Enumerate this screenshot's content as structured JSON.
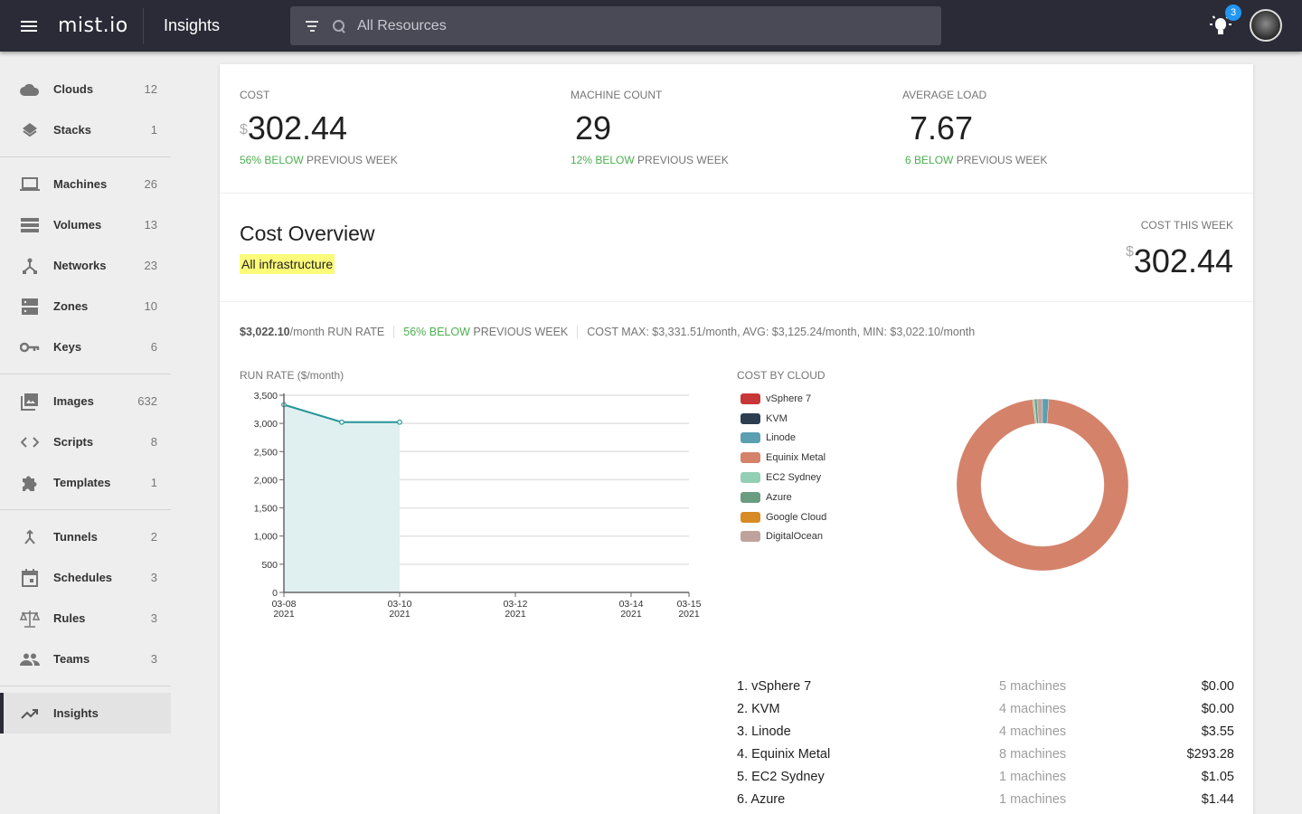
{
  "topbar": {
    "logo": "mist.io",
    "page_title": "Insights",
    "search_placeholder": "All Resources",
    "notification_count": "3"
  },
  "sidebar": {
    "groups": [
      [
        {
          "label": "Clouds",
          "count": "12",
          "icon": "cloud-icon"
        },
        {
          "label": "Stacks",
          "count": "1",
          "icon": "layers-icon"
        }
      ],
      [
        {
          "label": "Machines",
          "count": "26",
          "icon": "laptop-icon"
        },
        {
          "label": "Volumes",
          "count": "13",
          "icon": "storage-icon"
        },
        {
          "label": "Networks",
          "count": "23",
          "icon": "network-icon"
        },
        {
          "label": "Zones",
          "count": "10",
          "icon": "dns-icon"
        },
        {
          "label": "Keys",
          "count": "6",
          "icon": "key-icon"
        }
      ],
      [
        {
          "label": "Images",
          "count": "632",
          "icon": "images-icon"
        },
        {
          "label": "Scripts",
          "count": "8",
          "icon": "code-icon"
        },
        {
          "label": "Templates",
          "count": "1",
          "icon": "puzzle-icon"
        }
      ],
      [
        {
          "label": "Tunnels",
          "count": "2",
          "icon": "merge-icon"
        },
        {
          "label": "Schedules",
          "count": "3",
          "icon": "calendar-icon"
        },
        {
          "label": "Rules",
          "count": "3",
          "icon": "scale-icon"
        },
        {
          "label": "Teams",
          "count": "3",
          "icon": "people-icon"
        }
      ],
      [
        {
          "label": "Insights",
          "count": "",
          "icon": "trending-up-icon",
          "active": true
        }
      ]
    ]
  },
  "kpis": [
    {
      "label": "COST",
      "currency": "$",
      "value": "302.44",
      "delta": "56% BELOW",
      "suffix": " PREVIOUS WEEK"
    },
    {
      "label": "MACHINE COUNT",
      "currency": "",
      "value": "29",
      "delta": "12% BELOW",
      "suffix": " PREVIOUS WEEK"
    },
    {
      "label": "AVERAGE LOAD",
      "currency": "",
      "value": "7.67",
      "delta": "6 BELOW",
      "suffix": " PREVIOUS WEEK"
    }
  ],
  "overview": {
    "title": "Cost Overview",
    "filter_chip": "All infrastructure",
    "cost_this_week_label": "COST THIS WEEK",
    "cost_this_week_currency": "$",
    "cost_this_week_value": "302.44"
  },
  "runrate": {
    "amount": "$3,022.10",
    "amount_suffix": "/month RUN RATE",
    "delta": "56% BELOW",
    "delta_suffix": " PREVIOUS WEEK",
    "stats": "COST MAX: $3,331.51/month, AVG: $3,125.24/month, MIN: $3,022.10/month"
  },
  "chart_data": [
    {
      "type": "area",
      "title": "RUN RATE ($/month)",
      "xlabel": "",
      "ylabel": "",
      "x": [
        "2021-03-08",
        "2021-03-09",
        "2021-03-10"
      ],
      "values": [
        3331.51,
        3022.1,
        3022.1
      ],
      "xlim": [
        "2021-03-08",
        "2021-03-15"
      ],
      "ylim": [
        0,
        3500
      ],
      "yticks": [
        0,
        500,
        1000,
        1500,
        2000,
        2500,
        3000,
        3500
      ],
      "ytick_labels": [
        "0",
        "500",
        "1,000",
        "1,500",
        "2,000",
        "2,500",
        "3,000",
        "3,500"
      ],
      "xticks": [
        {
          "date": "2021-03-08",
          "label1": "03-08",
          "label2": "2021"
        },
        {
          "date": "2021-03-10",
          "label1": "03-10",
          "label2": "2021"
        },
        {
          "date": "2021-03-12",
          "label1": "03-12",
          "label2": "2021"
        },
        {
          "date": "2021-03-14",
          "label1": "03-14",
          "label2": "2021"
        },
        {
          "date": "2021-03-15",
          "label1": "03-15",
          "label2": "2021"
        }
      ],
      "grid": true,
      "line_color": "#26969a",
      "fill_color": "#e0f0f0"
    },
    {
      "type": "pie",
      "title": "COST BY CLOUD",
      "donut": true,
      "legend_position": "left",
      "categories": [
        "vSphere 7",
        "KVM",
        "Linode",
        "Equinix Metal",
        "EC2 Sydney",
        "Azure",
        "Google Cloud",
        "DigitalOcean"
      ],
      "values": [
        0.0,
        0.0,
        3.55,
        293.28,
        1.05,
        1.44,
        0.0,
        3.12
      ],
      "colors": [
        "#c83737",
        "#2c3e50",
        "#5b9fb0",
        "#d4826a",
        "#93cfb4",
        "#6a9c80",
        "#d78b25",
        "#c0a29c"
      ]
    }
  ],
  "cloud_list": [
    {
      "rank": "1. vSphere 7",
      "machines": "5 machines",
      "cost": "$0.00"
    },
    {
      "rank": "2. KVM",
      "machines": "4 machines",
      "cost": "$0.00"
    },
    {
      "rank": "3. Linode",
      "machines": "4 machines",
      "cost": "$3.55"
    },
    {
      "rank": "4. Equinix Metal",
      "machines": "8 machines",
      "cost": "$293.28"
    },
    {
      "rank": "5. EC2 Sydney",
      "machines": "1 machines",
      "cost": "$1.05"
    },
    {
      "rank": "6. Azure",
      "machines": "1 machines",
      "cost": "$1.44"
    }
  ]
}
